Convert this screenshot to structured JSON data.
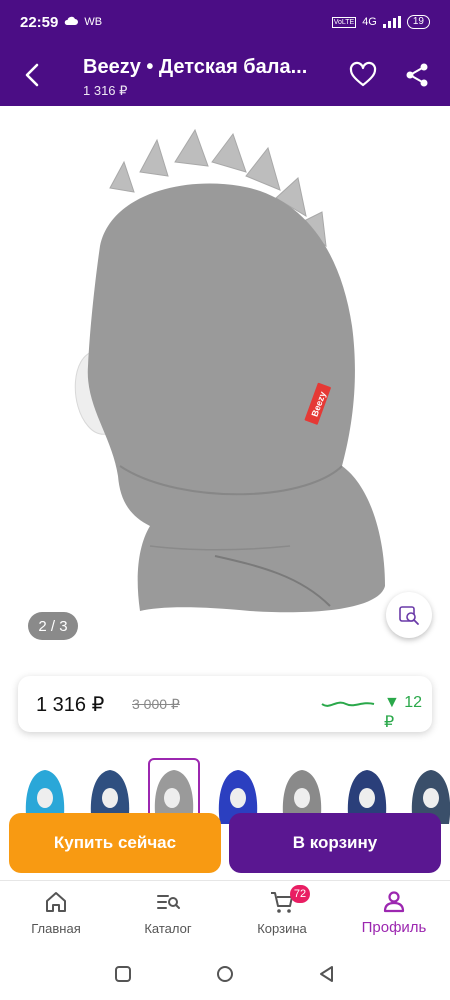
{
  "status_bar": {
    "time": "22:59",
    "carrier": "WB",
    "network": "4G",
    "volte": "VoLTE",
    "battery": "19",
    "icons": [
      "cloud-icon",
      "signal-icon",
      "battery-icon"
    ]
  },
  "app_bar": {
    "title": "Beezy • Детская бала...",
    "subtitle": "1 316 ₽",
    "icons": [
      "back-arrow-icon",
      "heart-icon",
      "share-icon"
    ]
  },
  "gallery": {
    "page_indicator": "2 / 3",
    "brand_tag": "Beezy",
    "visual_search_icon": "visual-search-icon"
  },
  "price": {
    "current": "1 316 ₽",
    "old": "3 000 ₽",
    "change": "▼ 12 ₽",
    "trend_color": "#2aa84a"
  },
  "thumbnails": {
    "count": 8,
    "selected_index": 2,
    "colors": [
      "#2aa7d8",
      "#2f4f80",
      "#9a9a9a",
      "#2b3fc0",
      "#8a8a8a",
      "#2a3f7a",
      "#3a4f6a",
      "#cccccc"
    ]
  },
  "actions": {
    "buy_now": "Купить сейчас",
    "add_to_cart": "В корзину",
    "buy_color": "#f89a12",
    "cart_color": "#5a1791"
  },
  "bottom_nav": {
    "items": [
      {
        "label": "Главная",
        "icon": "home-icon"
      },
      {
        "label": "Каталог",
        "icon": "catalog-search-icon"
      },
      {
        "label": "Корзина",
        "icon": "cart-icon",
        "badge": "72"
      },
      {
        "label": "Профиль",
        "icon": "profile-icon"
      }
    ],
    "active_index": 3,
    "active_color": "#9c27b0"
  },
  "system_nav": {
    "icons": [
      "recents-icon",
      "home-circle-icon",
      "back-triangle-icon"
    ]
  },
  "colors": {
    "brand": "#4b0d85"
  }
}
